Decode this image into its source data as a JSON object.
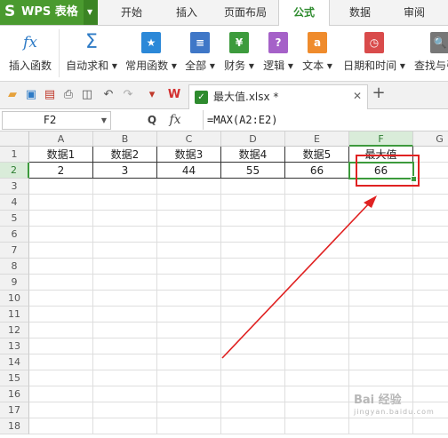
{
  "app": {
    "name": "WPS 表格",
    "logo_letter": "S"
  },
  "menu_tabs": [
    {
      "label": "开始",
      "active": false
    },
    {
      "label": "插入",
      "active": false
    },
    {
      "label": "页面布局",
      "active": false
    },
    {
      "label": "公式",
      "active": true
    },
    {
      "label": "数据",
      "active": false
    },
    {
      "label": "审阅",
      "active": false
    }
  ],
  "ribbon": {
    "insert_function": {
      "label": "插入函数",
      "icon": "fx"
    },
    "autosum": {
      "label": "自动求和",
      "icon": "Σ"
    },
    "common_functions": {
      "label": "常用函数",
      "icon": "★"
    },
    "all": {
      "label": "全部",
      "icon": "≡"
    },
    "finance": {
      "label": "财务",
      "icon": "¥"
    },
    "logic": {
      "label": "逻辑",
      "icon": "?"
    },
    "text": {
      "label": "文本",
      "icon": "a"
    },
    "datetime": {
      "label": "日期和时间",
      "icon": "◷"
    },
    "lookup": {
      "label": "查找与引",
      "icon": "🔍"
    }
  },
  "document": {
    "name": "最大值.xlsx *",
    "close": "✕",
    "new_tab": "+"
  },
  "formula_bar": {
    "cell_ref": "F2",
    "formula": "=MAX(A2:E2)",
    "fx": "fx",
    "zoom_icon": "Q"
  },
  "columns": [
    "A",
    "B",
    "C",
    "D",
    "E",
    "F",
    "G"
  ],
  "rows": [
    "1",
    "2",
    "3",
    "4",
    "5",
    "6",
    "7",
    "8",
    "9",
    "10",
    "11",
    "12",
    "13",
    "14",
    "15",
    "16",
    "17",
    "18"
  ],
  "table": {
    "headers": [
      "数据1",
      "数据2",
      "数据3",
      "数据4",
      "数据5",
      "最大值"
    ],
    "values": [
      "2",
      "3",
      "44",
      "55",
      "66",
      "66"
    ]
  },
  "colors": {
    "brand": "#4a9a2f",
    "active_tab": "#2e8b2e",
    "highlight": "#e02222",
    "selection": "#3c9a3c"
  },
  "watermark": {
    "text": "Bai 经验",
    "sub": "jingyan.baidu.com"
  }
}
